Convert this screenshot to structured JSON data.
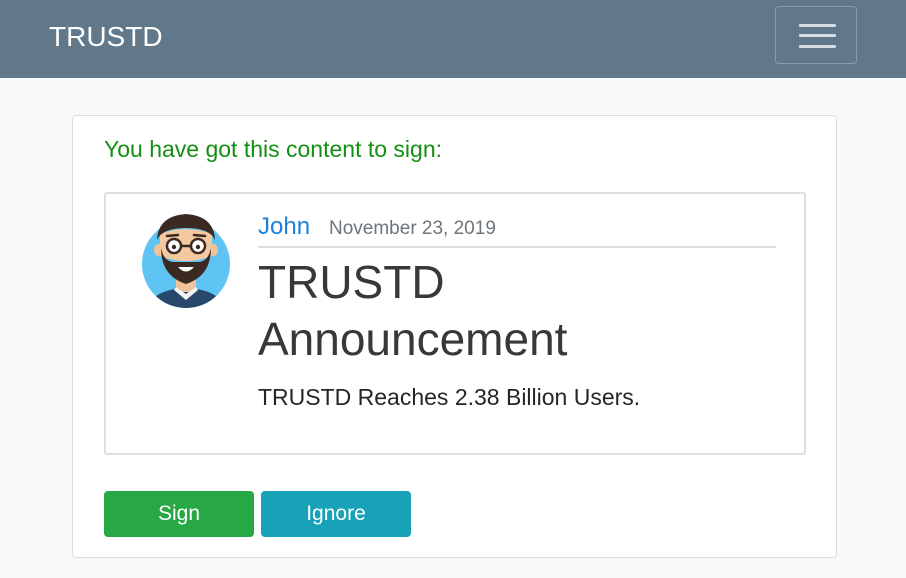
{
  "navbar": {
    "brand": "TRUSTD",
    "toggle_icon": "hamburger-menu-icon"
  },
  "request": {
    "prompt": "You have got this content to sign:"
  },
  "post": {
    "author": "John",
    "date": "November 23, 2019",
    "title": "TRUSTD Announcement",
    "body": "TRUSTD Reaches 2.38 Billion Users.",
    "avatar_icon": "user-avatar-icon"
  },
  "actions": {
    "sign_label": "Sign",
    "ignore_label": "Ignore"
  },
  "colors": {
    "navbar": "#607889",
    "prompt": "#138f13",
    "author_link": "#1a80d9",
    "sign_button": "#28a745",
    "ignore_button": "#17a2b8"
  }
}
